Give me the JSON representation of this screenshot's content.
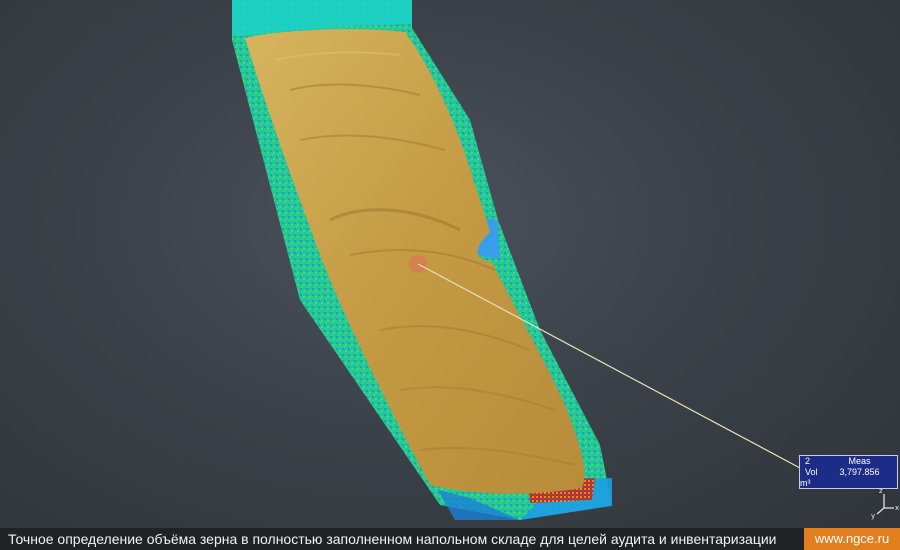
{
  "measurement": {
    "index": "2",
    "header": "Meas",
    "label": "Vol",
    "value": "3,797.856",
    "unit": "m³"
  },
  "caption": {
    "text": "Точное определение объёма зерна в полностью заполненном напольном складе для целей аудита и инвентаризации",
    "site": "www.ngce.ru"
  },
  "colors": {
    "grain": "#c8a24e",
    "wall": "#27d9a0",
    "scan_blue": "#2f8fe6",
    "measurement_box": "#1d2c86",
    "site_badge": "#e27e1d"
  },
  "icons": [
    "axis-triad-icon",
    "measurement-marker-icon"
  ]
}
